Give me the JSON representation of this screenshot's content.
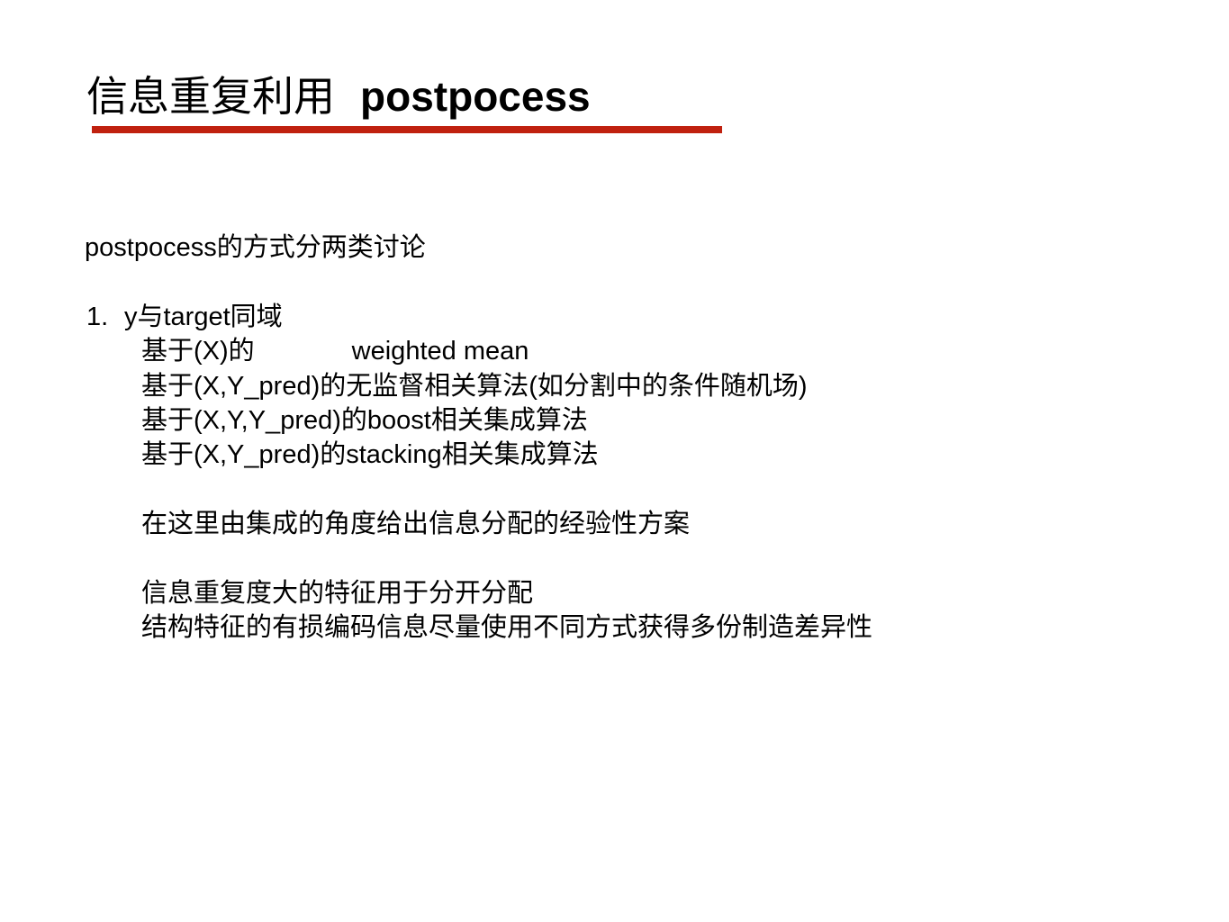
{
  "slide": {
    "title_zh": "信息重复利用",
    "title_en": "postpocess",
    "accent_color": "#c0210f",
    "intro": "postpocess的方式分两类讨论",
    "item1_number": "1.",
    "item1_text": "y与target同域",
    "line_a_prefix": "基于(X)的",
    "line_a_suffix": "weighted mean",
    "line_b": "基于(X,Y_pred)的无监督相关算法(如分割中的条件随机场)",
    "line_c": "基于(X,Y,Y_pred)的boost相关集成算法",
    "line_d": "基于(X,Y_pred)的stacking相关集成算法",
    "line_e": "在这里由集成的角度给出信息分配的经验性方案",
    "line_f": "信息重复度大的特征用于分开分配",
    "line_g": "结构特征的有损编码信息尽量使用不同方式获得多份制造差异性"
  }
}
